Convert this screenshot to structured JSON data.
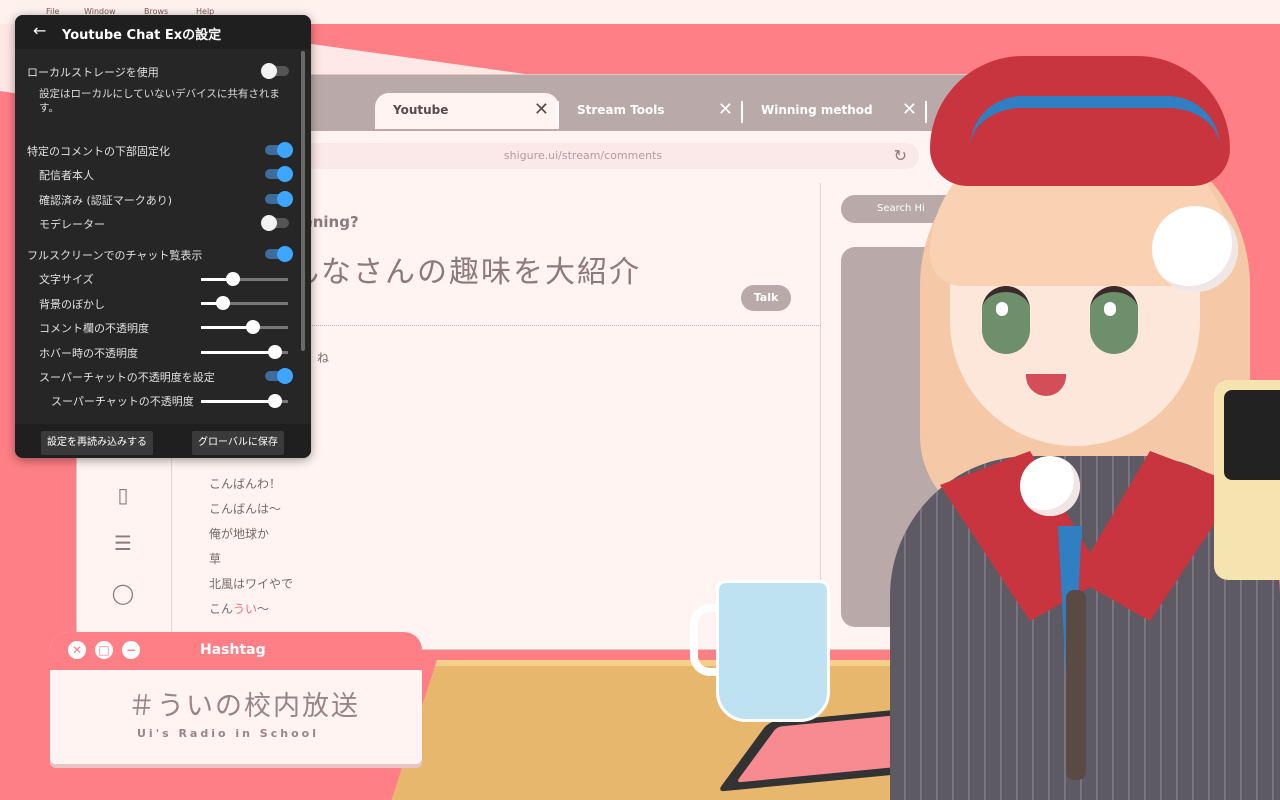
{
  "menubar": {
    "items": [
      "File",
      "Window",
      "Brows",
      "Help"
    ]
  },
  "browser": {
    "tabs": [
      {
        "label": ""
      },
      {
        "label": "Youtube"
      },
      {
        "label": "Stream Tools"
      },
      {
        "label": "Winning method"
      }
    ],
    "close_glyph": "✕",
    "new_tab_glyph": "+",
    "address": "shigure.ui/stream/comments",
    "feed_title": "What's happening?",
    "stream_title": "みんなさんの趣味を大紹介",
    "talk_button": "Talk",
    "search_placeholder": "Search Hi",
    "comments": [
      "ね",
      "こんばんわ！",
      "こんばんは～",
      "俺が地球か",
      "草",
      "北風はワイやで"
    ],
    "last_comment_prefix": "こん",
    "last_comment_highlight": "うい",
    "last_comment_suffix": "～"
  },
  "hashtag": {
    "title": "Hashtag",
    "tag": "＃ういの校内放送",
    "subtitle": "Ui's Radio in School"
  },
  "settings": {
    "title": "Youtube Chat Exの設定",
    "local_storage": {
      "label": "ローカルストレージを使用",
      "on": false
    },
    "local_storage_desc": "設定はローカルにしていないデバイスに共有されます。",
    "pin_comments": {
      "label": "特定のコメントの下部固定化",
      "on": true
    },
    "pin_owner": {
      "label": "配信者本人",
      "on": true
    },
    "pin_verified": {
      "label": "確認済み (認証マークあり)",
      "on": true
    },
    "pin_moderator": {
      "label": "モデレーター",
      "on": false
    },
    "fullscreen_chat": {
      "label": "フルスクリーンでのチャット覧表示",
      "on": true
    },
    "font_size": {
      "label": "文字サイズ",
      "value": 0.37
    },
    "bg_blur": {
      "label": "背景のぼかし",
      "value": 0.25
    },
    "comment_opacity": {
      "label": "コメント欄の不透明度",
      "value": 0.6
    },
    "hover_opacity": {
      "label": "ホバー時の不透明度",
      "value": 0.85
    },
    "superchat_opacity_set": {
      "label": "スーパーチャットの不透明度を設定",
      "on": true
    },
    "superchat_opacity": {
      "label": "スーパーチャットの不透明度",
      "value": 0.85
    },
    "reload_button": "設定を再読み込みする",
    "save_global_button": "グローバルに保存"
  },
  "colors": {
    "accent": "#3ea6ff",
    "brand_pink": "#ff7f86"
  }
}
